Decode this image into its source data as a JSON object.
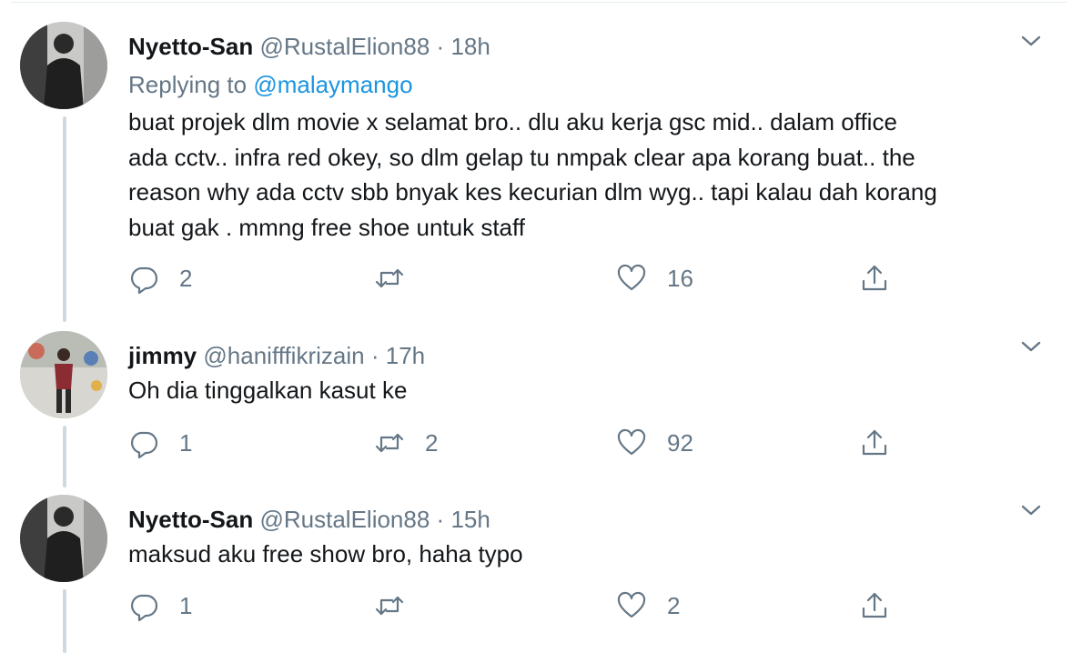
{
  "tweets": [
    {
      "name": "Nyetto-San",
      "handle": "@RustalElion88",
      "separator": "·",
      "time": "18h",
      "replying_prefix": "Replying to ",
      "replying_to": "@malaymango",
      "body_lines": [
        "buat projek dlm movie x selamat bro.. dlu aku kerja gsc mid.. dalam office",
        "ada cctv.. infra red okey, so dlm gelap tu nmpak clear apa korang buat.. the",
        "reason why ada cctv sbb bnyak kes kecurian dlm wyg.. tapi kalau dah korang",
        "buat gak . mmng free shoe untuk staff"
      ],
      "reply_count": "2",
      "retweet_count": "",
      "like_count": "16"
    },
    {
      "name": "jimmy",
      "handle": "@hanifffikrizain",
      "separator": "·",
      "time": "17h",
      "body_lines": [
        "Oh dia tinggalkan kasut ke"
      ],
      "reply_count": "1",
      "retweet_count": "2",
      "like_count": "92"
    },
    {
      "name": "Nyetto-San",
      "handle": "@RustalElion88",
      "separator": "·",
      "time": "15h",
      "body_lines": [
        "maksud aku free show bro, haha typo"
      ],
      "reply_count": "1",
      "retweet_count": "",
      "like_count": "2"
    }
  ],
  "icons": {
    "reply": "reply-icon",
    "retweet": "retweet-icon",
    "like": "like-icon",
    "share": "share-icon",
    "more": "chevron-down-icon"
  },
  "colors": {
    "text": "#14171a",
    "secondary": "#657786",
    "link": "#1b95e0",
    "thread_line": "#cfd9de"
  }
}
